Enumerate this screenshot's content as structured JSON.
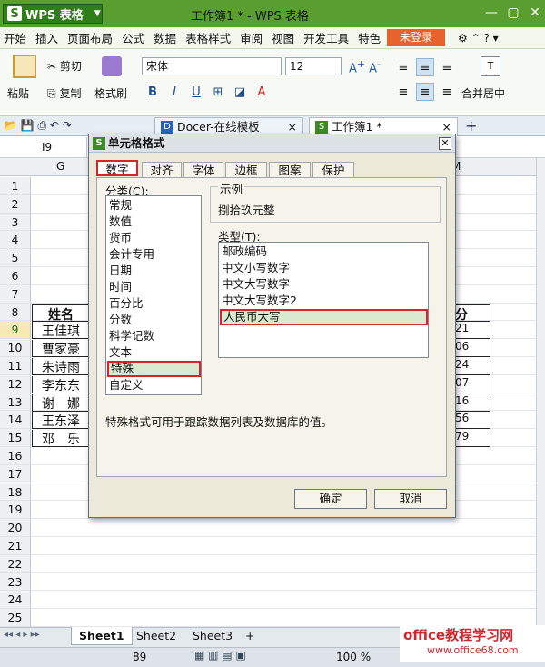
{
  "app": {
    "name": "WPS 表格",
    "doc_title": "工作簿1 * - WPS 表格"
  },
  "menu": [
    "开始",
    "插入",
    "页面布局",
    "公式",
    "数据",
    "表格样式",
    "审阅",
    "视图",
    "开发工具",
    "特色"
  ],
  "login": "未登录",
  "ribbon": {
    "paste": "粘贴",
    "cut": "剪切",
    "copy": "复制",
    "format_painter": "格式刷",
    "font": "宋体",
    "size": "12",
    "merge": "合并居中"
  },
  "tabs": {
    "docer": "Docer-在线模板",
    "workbook": "工作簿1 *"
  },
  "name_box": "I9",
  "columns": {
    "g": "G",
    "m": "M"
  },
  "rows": [
    "1",
    "2",
    "3",
    "4",
    "5",
    "6",
    "7",
    "8",
    "9",
    "10",
    "11",
    "12",
    "13",
    "14",
    "15",
    "16",
    "17",
    "18",
    "19",
    "20",
    "21",
    "22",
    "23",
    "24",
    "25"
  ],
  "table": {
    "name_header": "姓名",
    "score_header": "分",
    "names": [
      "王佳琪",
      "曹家豪",
      "朱诗雨",
      "李东东",
      "谢　娜",
      "王东泽",
      "邓　乐"
    ],
    "scores": [
      "21",
      "06",
      "24",
      "07",
      "16",
      "56",
      "79"
    ]
  },
  "dialog": {
    "title": "单元格格式",
    "tabs": [
      "数字",
      "对齐",
      "字体",
      "边框",
      "图案",
      "保护"
    ],
    "category_label": "分类(C):",
    "categories": [
      "常规",
      "数值",
      "货币",
      "会计专用",
      "日期",
      "时间",
      "百分比",
      "分数",
      "科学记数",
      "文本",
      "特殊",
      "自定义"
    ],
    "example_label": "示例",
    "example_value": "捌拾玖元整",
    "type_label": "类型(T):",
    "types": [
      "邮政编码",
      "中文小写数字",
      "中文大写数字",
      "中文大写数字2",
      "人民币大写"
    ],
    "description": "特殊格式可用于跟踪数据列表及数据库的值。",
    "ok": "确定",
    "cancel": "取消"
  },
  "sheets": [
    "Sheet1",
    "Sheet2",
    "Sheet3"
  ],
  "status": {
    "value": "89",
    "zoom": "100 %"
  },
  "watermark": {
    "line1": "office教程学习网",
    "line2": "www.office68.com"
  }
}
